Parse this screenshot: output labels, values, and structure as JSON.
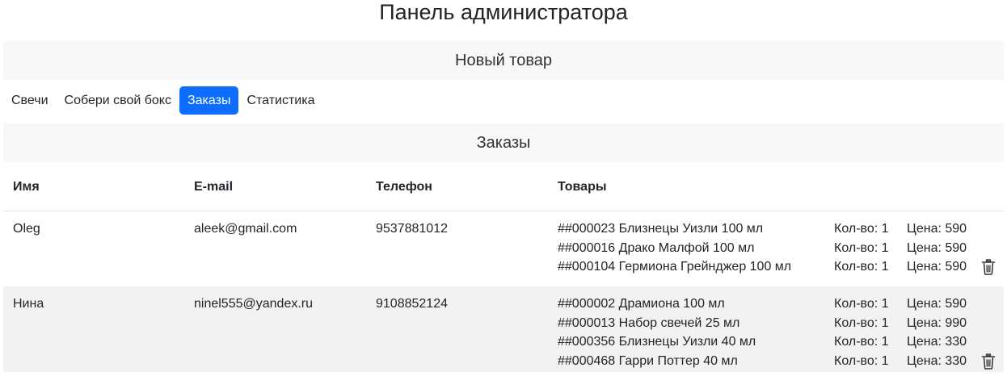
{
  "page": {
    "title": "Панель администратора"
  },
  "new_product_bar": {
    "label": "Новый товар"
  },
  "tabs": [
    {
      "label": "Свечи",
      "active": false
    },
    {
      "label": "Собери свой бокс",
      "active": false
    },
    {
      "label": "Заказы",
      "active": true
    },
    {
      "label": "Статистика",
      "active": false
    }
  ],
  "orders_section": {
    "title": "Заказы",
    "columns": [
      "Имя",
      "E-mail",
      "Телефон",
      "Товары"
    ],
    "rows": [
      {
        "name": "Oleg",
        "email": "aleek@gmail.com",
        "phone": "9537881012",
        "items": [
          {
            "name": "##000023 Близнецы Уизли 100 мл",
            "qty": "Кол-во: 1",
            "price": "Цена: 590"
          },
          {
            "name": "##000016 Драко Малфой 100 мл",
            "qty": "Кол-во: 1",
            "price": "Цена: 590"
          },
          {
            "name": "##000104 Гермиона Грейнджер 100 мл",
            "qty": "Кол-во: 1",
            "price": "Цена: 590"
          }
        ]
      },
      {
        "name": "Нина",
        "email": "ninel555@yandex.ru",
        "phone": "9108852124",
        "items": [
          {
            "name": "##000002 Драмиона 100 мл",
            "qty": "Кол-во: 1",
            "price": "Цена: 590"
          },
          {
            "name": "##000013 Набор свечей 25 мл",
            "qty": "Кол-во: 1",
            "price": "Цена: 990"
          },
          {
            "name": "##000356 Близнецы Уизли 40 мл",
            "qty": "Кол-во: 1",
            "price": "Цена: 330"
          },
          {
            "name": "##000468 Гарри Поттер 40 мл",
            "qty": "Кол-во: 1",
            "price": "Цена: 330"
          }
        ]
      }
    ],
    "delete_icon": "trash-icon"
  },
  "colors": {
    "accent": "#0d6efd",
    "bar_background": "#f8f8f8",
    "striped_row": "#f2f2f2"
  }
}
